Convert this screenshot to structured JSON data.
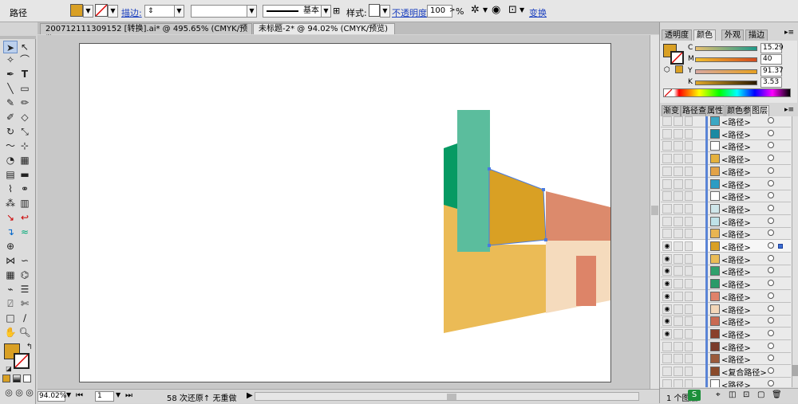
{
  "control_bar": {
    "object_type": "路径",
    "stroke_label": "描边:",
    "style_preview_label": "基本",
    "style_label": "样式:",
    "opacity_label": "不透明度",
    "opacity_value": "100",
    "opacity_unit": ">",
    "percent": "%",
    "transform_label": "变换",
    "fill_color": "#d9a024"
  },
  "doc_tabs": [
    {
      "label": "200712111309152 [转换].ai* @ 495.65% (CMYK/预览)",
      "active": false
    },
    {
      "label": "未标题-2* @ 94.02% (CMYK/预览)",
      "active": true
    }
  ],
  "status_bar": {
    "zoom": "94.02%",
    "page": "1",
    "undo_text": "58 次还原↑  无重做"
  },
  "panels": {
    "top_tabs": [
      "透明度",
      "颜色",
      "外观",
      "描边"
    ],
    "active_top_tab": "颜色",
    "cmyk": [
      {
        "label": "C",
        "value": "15.29"
      },
      {
        "label": "M",
        "value": "40"
      },
      {
        "label": "Y",
        "value": "91.37"
      },
      {
        "label": "K",
        "value": "3.53"
      }
    ],
    "lower_tabs": [
      "渐变",
      "路径查",
      "属性",
      "颜色参",
      "图层"
    ],
    "active_lower_tab": "图层",
    "layer_rows": [
      {
        "name": "<路径>",
        "eye": false,
        "thumb": "#3aa7c4",
        "selected": false
      },
      {
        "name": "<路径>",
        "eye": false,
        "thumb": "#1a8aa3",
        "selected": false
      },
      {
        "name": "<路径>",
        "eye": false,
        "thumb": "#ffffff",
        "selected": false
      },
      {
        "name": "<路径>",
        "eye": false,
        "thumb": "#e5b13c",
        "selected": false
      },
      {
        "name": "<路径>",
        "eye": false,
        "thumb": "#e3a247",
        "selected": false
      },
      {
        "name": "<路径>",
        "eye": false,
        "thumb": "#2c9cc4",
        "selected": false
      },
      {
        "name": "<路径>",
        "eye": false,
        "thumb": "#ffffff",
        "selected": false
      },
      {
        "name": "<路径>",
        "eye": false,
        "thumb": "#cfe6ea",
        "selected": false
      },
      {
        "name": "<路径>",
        "eye": false,
        "thumb": "#bfe2e8",
        "selected": false
      },
      {
        "name": "<路径>",
        "eye": false,
        "thumb": "#e8b552",
        "selected": false
      },
      {
        "name": "<路径>",
        "eye": true,
        "thumb": "#d9a024",
        "selected": true
      },
      {
        "name": "<路径>",
        "eye": true,
        "thumb": "#ebbc56",
        "selected": false
      },
      {
        "name": "<路径>",
        "eye": true,
        "thumb": "#30a06c",
        "selected": false
      },
      {
        "name": "<路径>",
        "eye": true,
        "thumb": "#2a9a68",
        "selected": false
      },
      {
        "name": "<路径>",
        "eye": true,
        "thumb": "#e0826a",
        "selected": false
      },
      {
        "name": "<路径>",
        "eye": true,
        "thumb": "#f3d6b8",
        "selected": false
      },
      {
        "name": "<路径>",
        "eye": true,
        "thumb": "#c96a52",
        "selected": false
      },
      {
        "name": "<路径>",
        "eye": true,
        "thumb": "#8a3f2a",
        "selected": false
      },
      {
        "name": "<路径>",
        "eye": false,
        "thumb": "#7a3b2a",
        "selected": false
      },
      {
        "name": "<路径>",
        "eye": false,
        "thumb": "#9a5a3a",
        "selected": false
      },
      {
        "name": "<复合路径>",
        "eye": false,
        "thumb": "#8a4a2a",
        "selected": false
      },
      {
        "name": "<路径>",
        "eye": false,
        "thumb": "#ffffff",
        "selected": false
      }
    ],
    "layer_count": "1 个图层"
  },
  "artwork_colors": {
    "teal": "#5bbd9d",
    "dark_green": "#069a63",
    "gold": "#d9a024",
    "light_gold": "#ebbb56",
    "salmon": "#dc8a6c",
    "peach": "#f5dbbd",
    "door": "#dd8468"
  }
}
